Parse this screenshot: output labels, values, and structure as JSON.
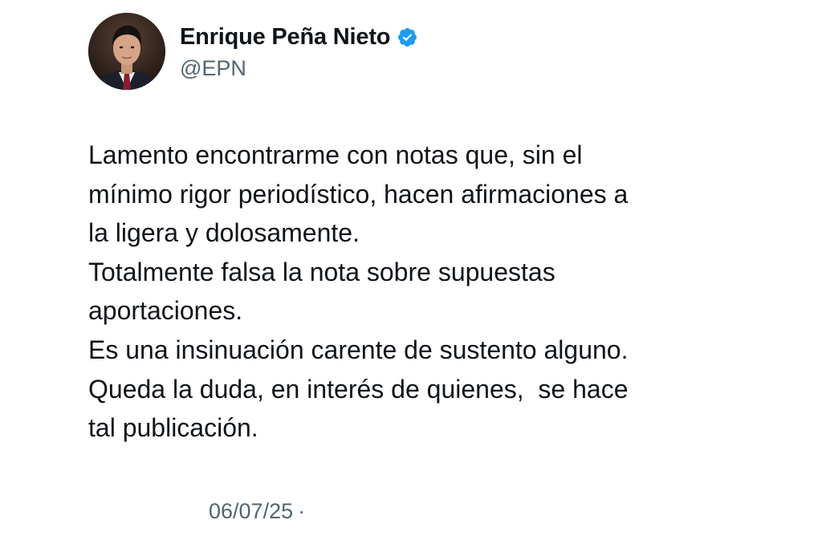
{
  "tweet": {
    "display_name": "Enrique Peña Nieto",
    "handle": "@EPN",
    "verified_color": "#1d9bf0",
    "text_lines": [
      "Lamento encontrarme con notas que, sin el",
      "mínimo rigor periodístico, hacen afirmaciones a",
      "la ligera y dolosamente.",
      "Totalmente falsa la nota sobre supuestas",
      "aportaciones.",
      "Es una insinuación carente de sustento alguno.",
      "Queda la duda, en interés de quienes,  se hace",
      "tal publicación."
    ],
    "date": "06/07/25",
    "separator": "·"
  },
  "icons": {
    "avatar": "avatar-photo",
    "verified": "verified-badge-icon"
  }
}
